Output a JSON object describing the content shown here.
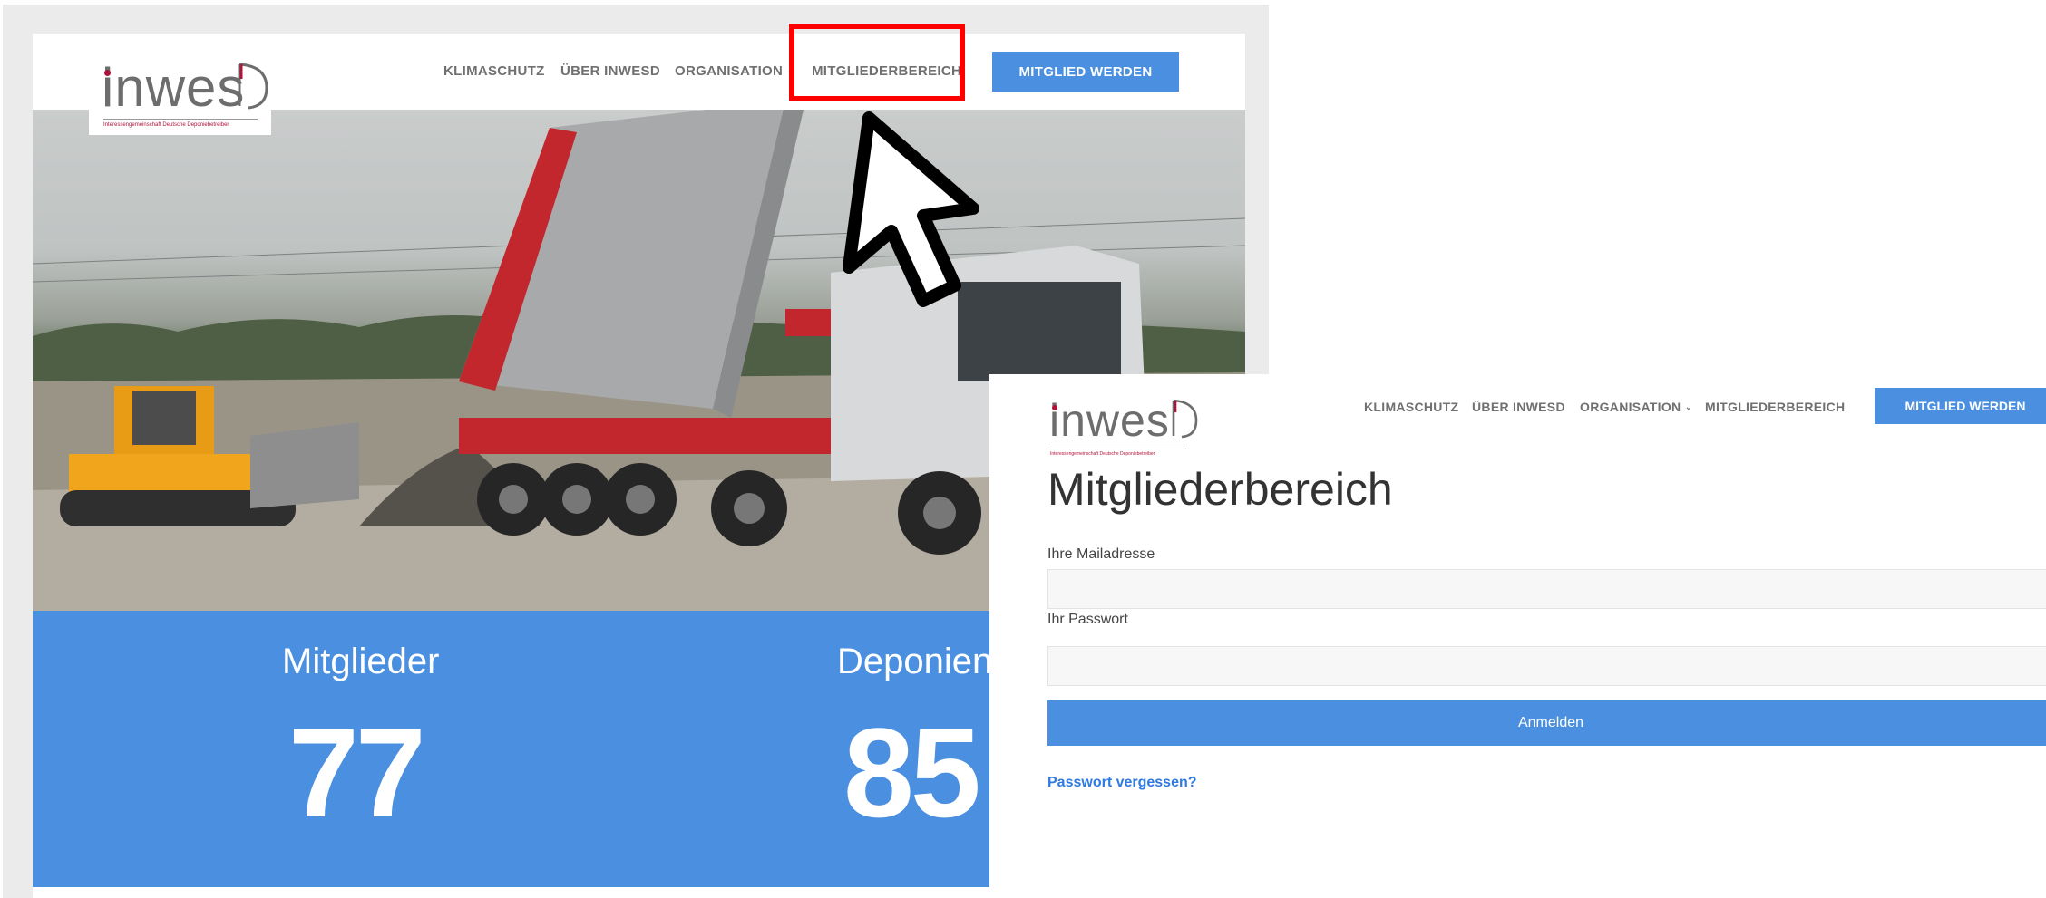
{
  "left_page": {
    "logo": {
      "text": "inwes",
      "tagline": "Interessengemeinschaft Deutsche Deponiebetreiber"
    },
    "nav": {
      "klimaschutz": "KLIMASCHUTZ",
      "ueber": "ÜBER INWESD",
      "organisation": "ORGANISATION",
      "mitgliederbereich": "MITGLIEDERBEREICH"
    },
    "cta": "MITGLIED WERDEN",
    "stats": [
      {
        "label": "Mitglieder",
        "value": "77"
      },
      {
        "label": "Deponien",
        "value": "85"
      }
    ]
  },
  "right_page": {
    "logo": {
      "text": "inwes",
      "tagline": "Interessengemeinschaft Deutsche Deponiebetreiber"
    },
    "nav": {
      "klimaschutz": "KLIMASCHUTZ",
      "ueber": "ÜBER INWESD",
      "organisation": "ORGANISATION",
      "mitgliederbereich": "MITGLIEDERBEREICH"
    },
    "cta": "MITGLIED WERDEN",
    "title": "Mitgliederbereich",
    "email_label": "Ihre Mailadresse",
    "password_label": "Ihr Passwort",
    "submit_label": "Anmelden",
    "forgot_label": "Passwort vergessen?"
  },
  "colors": {
    "accent": "#4a8fe0",
    "highlight": "#ff0000",
    "logo_red": "#b0123a"
  },
  "icons": {
    "cursor": "arrow-cursor-icon",
    "dropdown": "chevron-down-icon"
  }
}
